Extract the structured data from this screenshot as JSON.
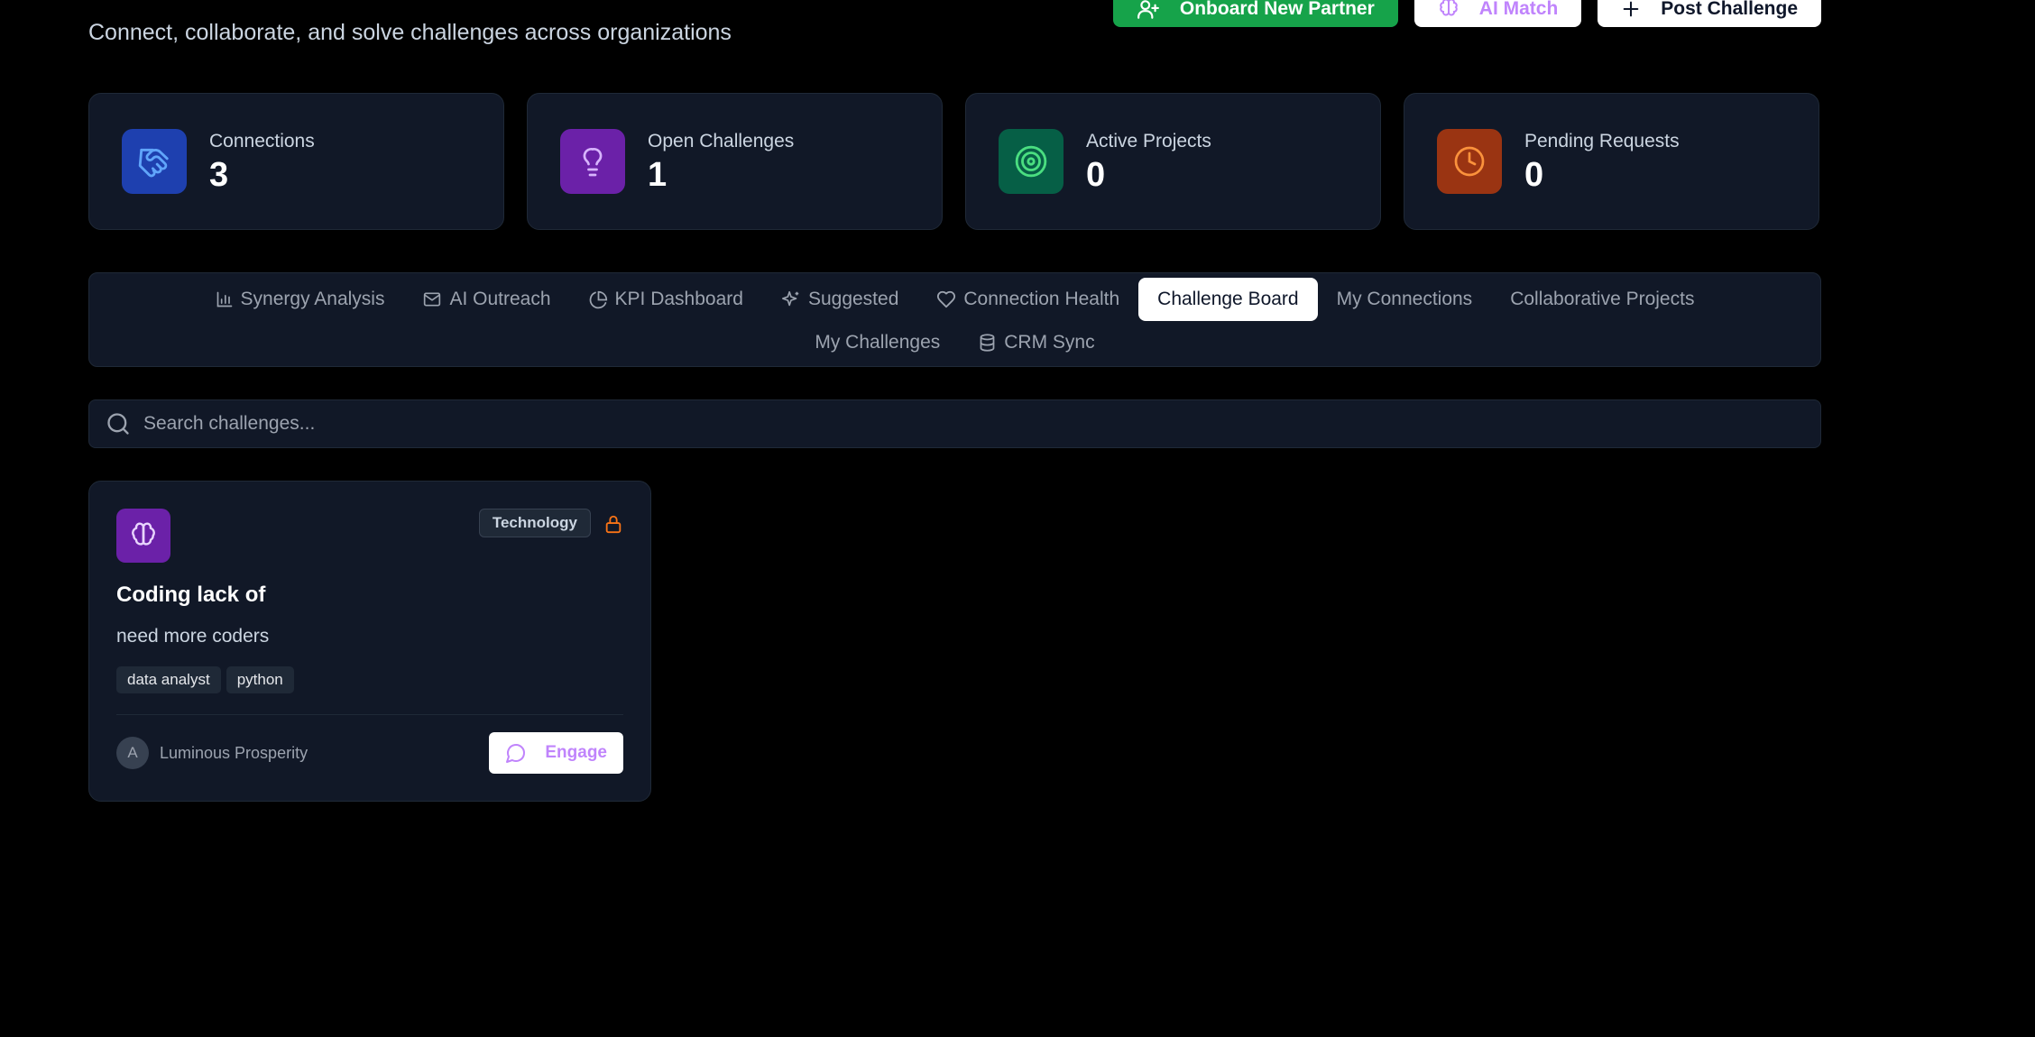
{
  "header": {
    "subtitle": "Connect, collaborate, and solve challenges across organizations",
    "actions": {
      "onboard_label": "Onboard New Partner",
      "ai_match_label": "AI Match",
      "post_challenge_label": "Post Challenge"
    }
  },
  "stats": [
    {
      "label": "Connections",
      "value": "3",
      "icon": "handshake-icon",
      "color": "#1e40af"
    },
    {
      "label": "Open Challenges",
      "value": "1",
      "icon": "lightbulb-icon",
      "color": "#6b21a8"
    },
    {
      "label": "Active Projects",
      "value": "0",
      "icon": "target-icon",
      "color": "#065f46"
    },
    {
      "label": "Pending Requests",
      "value": "0",
      "icon": "clock-icon",
      "color": "#9a3412"
    }
  ],
  "tabs": {
    "synergy": "Synergy Analysis",
    "outreach": "AI Outreach",
    "kpi": "KPI Dashboard",
    "suggested": "Suggested",
    "health": "Connection Health",
    "challenge_board": "Challenge Board",
    "my_connections": "My Connections",
    "collab_projects": "Collaborative Projects",
    "my_challenges": "My Challenges",
    "crm_sync": "CRM Sync",
    "active": "Challenge Board"
  },
  "search": {
    "placeholder": "Search challenges..."
  },
  "challenges": [
    {
      "category": "Technology",
      "title": "Coding lack of",
      "description": "need more coders",
      "tags": [
        "data analyst",
        "python"
      ],
      "org_initial": "A",
      "org_name": "Luminous Prosperity",
      "engage_label": "Engage"
    }
  ],
  "colors": {
    "background": "#000000",
    "card": "#111827",
    "accent_green": "#16a34a",
    "accent_purple": "#c084fc",
    "lock_orange": "#f97316"
  }
}
